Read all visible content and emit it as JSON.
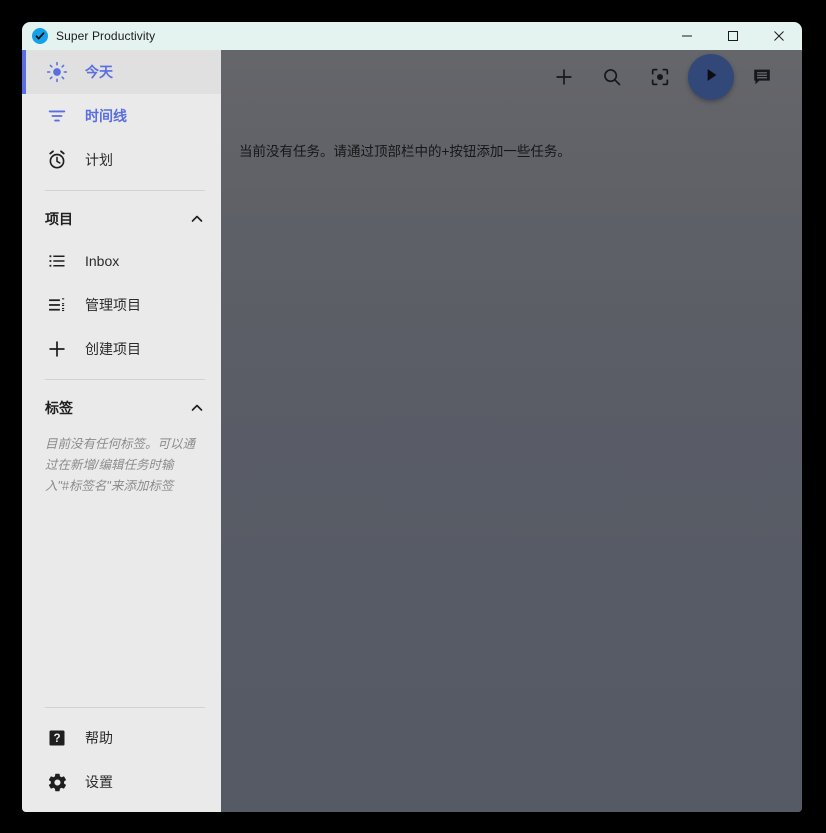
{
  "window": {
    "app_title": "Super Productivity",
    "app_icon": "check-circle-icon",
    "controls": {
      "minimize": "minimize-icon",
      "maximize": "maximize-icon",
      "close": "close-icon"
    }
  },
  "sidebar": {
    "nav": [
      {
        "label": "今天",
        "icon": "sun-icon",
        "active": true
      },
      {
        "label": "时间线",
        "icon": "timeline-filter-icon",
        "active": false
      },
      {
        "label": "计划",
        "icon": "alarm-clock-icon",
        "active": false
      }
    ],
    "projects_section": {
      "title": "项目",
      "collapse_icon": "chevron-up-icon",
      "items": [
        {
          "label": "Inbox",
          "icon": "list-bulleted-icon"
        },
        {
          "label": "管理项目",
          "icon": "list-edit-icon"
        },
        {
          "label": "创建项目",
          "icon": "plus-icon"
        }
      ]
    },
    "tags_section": {
      "title": "标签",
      "collapse_icon": "chevron-up-icon",
      "empty_text": "目前没有任何标签。可以通过在新增/编辑任务时输入\"#标签名\"来添加标签"
    },
    "bottom": [
      {
        "label": "帮助",
        "icon": "help-square-icon"
      },
      {
        "label": "设置",
        "icon": "gear-icon"
      }
    ]
  },
  "toolbar": {
    "buttons": [
      {
        "name": "add-task-button",
        "icon": "plus-icon"
      },
      {
        "name": "search-button",
        "icon": "search-icon"
      },
      {
        "name": "focus-mode-button",
        "icon": "center-focus-icon"
      },
      {
        "name": "play-button",
        "icon": "play-icon"
      },
      {
        "name": "notes-button",
        "icon": "notes-bubble-icon"
      }
    ]
  },
  "main": {
    "empty_message": "当前没有任务。请通过顶部栏中的+按钮添加一些任务。"
  },
  "colors": {
    "accent": "#5b6ee0",
    "fab": "#314878",
    "titlebar": "#e4f3f0",
    "sidebar": "#eaeaea",
    "content_bg": "#5a5d66"
  }
}
